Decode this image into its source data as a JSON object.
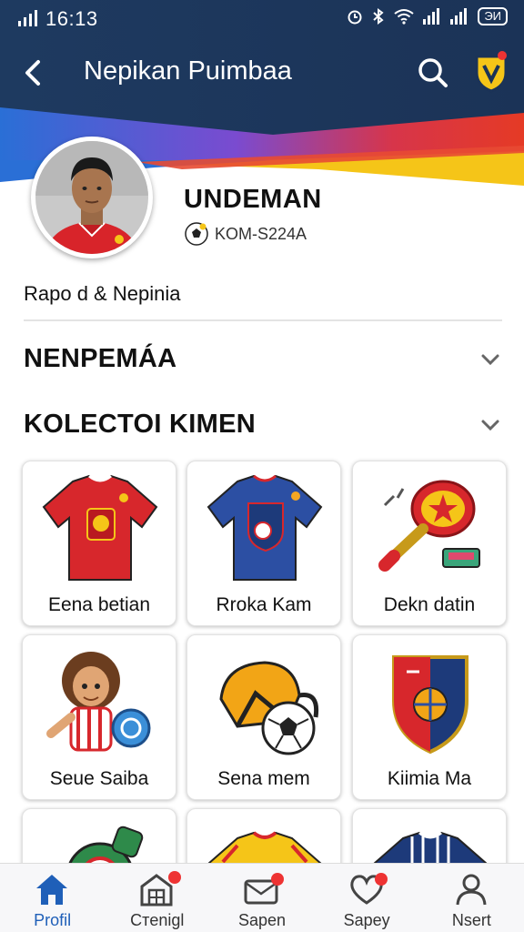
{
  "status_bar": {
    "time": "16:13",
    "battery": "ЭИ"
  },
  "header": {
    "title": "Nepikan Puimbaa"
  },
  "profile": {
    "name": "UNDEMAN",
    "code": "KOM-S224A",
    "bio": "Rapo d & Nepinia"
  },
  "sections": [
    {
      "label": "NENPEMÁA"
    },
    {
      "label": "KOLECTOI KIMEN"
    }
  ],
  "collection": [
    {
      "caption": "Eena betian",
      "icon": "red-jersey-icon"
    },
    {
      "caption": "Rroka Kam",
      "icon": "blue-jersey-icon"
    },
    {
      "caption": "Dekn datin",
      "icon": "trophy-racket-icon"
    },
    {
      "caption": "Seue Saiba",
      "icon": "mascot-figure-icon"
    },
    {
      "caption": "Sena mem",
      "icon": "helmet-ball-icon"
    },
    {
      "caption": "Kiimia Ma",
      "icon": "club-shield-icon"
    },
    {
      "caption": "",
      "icon": "mascot-cap-icon"
    },
    {
      "caption": "",
      "icon": "yellow-jersey-icon"
    },
    {
      "caption": "",
      "icon": "navy-jersey-icon"
    }
  ],
  "nav": [
    {
      "label": "Profil",
      "icon": "home-icon",
      "active": true
    },
    {
      "label": "Cтenigl",
      "icon": "shop-icon",
      "active": false
    },
    {
      "label": "Sapen",
      "icon": "mail-icon",
      "active": false
    },
    {
      "label": "Sapey",
      "icon": "heart-icon",
      "active": false
    },
    {
      "label": "Nsert",
      "icon": "user-icon",
      "active": false
    }
  ],
  "colors": {
    "header_navy": "#1d3a64",
    "accent_blue": "#1f5fb8",
    "stripe_red": "#e23a2c",
    "stripe_yellow": "#f5c518",
    "stripe_purple": "#7b4bd1"
  }
}
